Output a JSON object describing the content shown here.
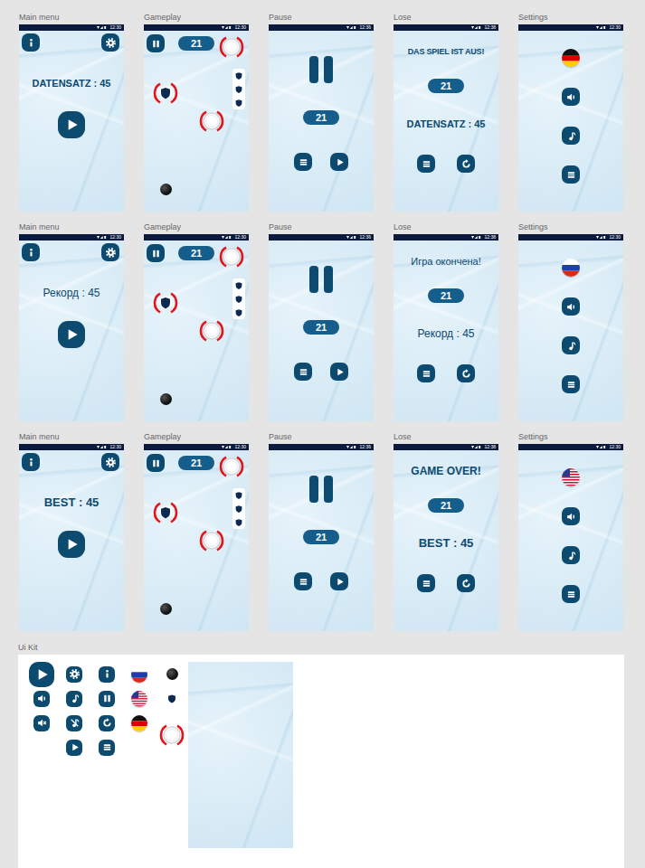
{
  "rows": [
    {
      "language": "de",
      "screens": [
        {
          "kind": "main-menu",
          "label": "Main menu",
          "time": "12:30",
          "record": "DATENSATZ : 45"
        },
        {
          "kind": "gameplay",
          "label": "Gameplay",
          "time": "12:30",
          "score": "21",
          "lives": 3
        },
        {
          "kind": "pause",
          "label": "Pause",
          "time": "12:36",
          "score": "21"
        },
        {
          "kind": "lose",
          "label": "Lose",
          "time": "12:38",
          "title": "DAS SPIEL IST AUS!",
          "score": "21",
          "record": "DATENSATZ : 45"
        },
        {
          "kind": "settings",
          "label": "Settings",
          "time": "12:30",
          "sound_on": true,
          "music_on": true
        }
      ]
    },
    {
      "language": "ru",
      "screens": [
        {
          "kind": "main-menu",
          "label": "Main menu",
          "time": "12:30",
          "record": "Рекорд : 45"
        },
        {
          "kind": "gameplay",
          "label": "Gameplay",
          "time": "12:30",
          "score": "21",
          "lives": 3
        },
        {
          "kind": "pause",
          "label": "Pause",
          "time": "12:36",
          "score": "21"
        },
        {
          "kind": "lose",
          "label": "Lose",
          "time": "12:38",
          "title": "Игра окончена!",
          "score": "21",
          "record": "Рекорд : 45"
        },
        {
          "kind": "settings",
          "label": "Settings",
          "time": "12:30",
          "sound_on": true,
          "music_on": true
        }
      ]
    },
    {
      "language": "en",
      "screens": [
        {
          "kind": "main-menu",
          "label": "Main menu",
          "time": "12:30",
          "record": "BEST : 45"
        },
        {
          "kind": "gameplay",
          "label": "Gameplay",
          "time": "12:30",
          "score": "21",
          "lives": 3
        },
        {
          "kind": "pause",
          "label": "Pause",
          "time": "12:36",
          "score": "21"
        },
        {
          "kind": "lose",
          "label": "Lose",
          "time": "12:38",
          "title": "GAME OVER!",
          "score": "21",
          "record": "BEST : 45"
        },
        {
          "kind": "settings",
          "label": "Settings",
          "time": "12:30",
          "sound_on": true,
          "music_on": true
        }
      ]
    }
  ],
  "ui_kit": {
    "label": "Ui Kit"
  }
}
